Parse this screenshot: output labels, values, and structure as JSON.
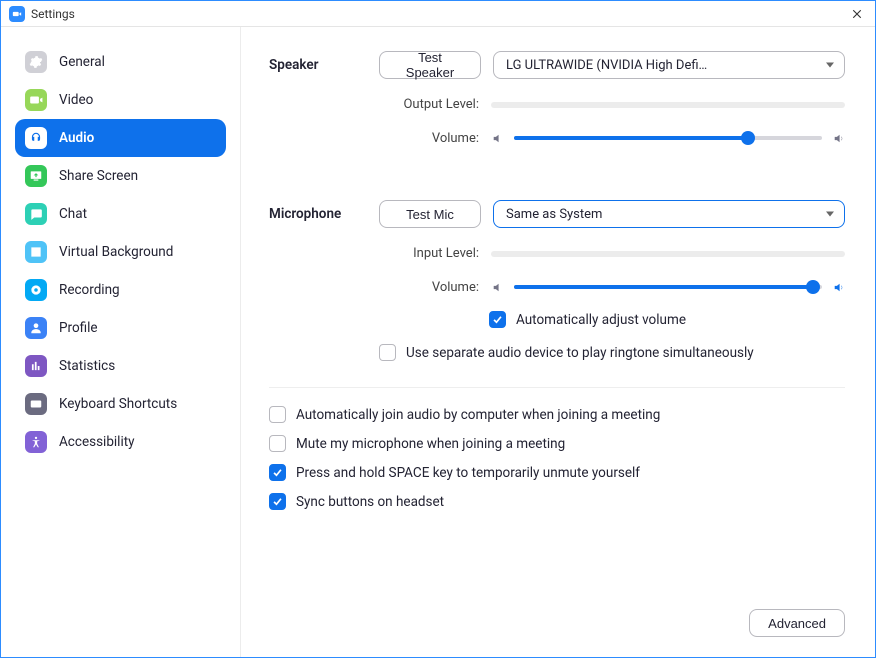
{
  "window": {
    "title": "Settings"
  },
  "sidebar": {
    "items": [
      {
        "label": "General",
        "active": false,
        "icon_bg": "#d0d0d6"
      },
      {
        "label": "Video",
        "active": false,
        "icon_bg": "#97d759"
      },
      {
        "label": "Audio",
        "active": true,
        "icon_bg": "#ffffff"
      },
      {
        "label": "Share Screen",
        "active": false,
        "icon_bg": "#34c759"
      },
      {
        "label": "Chat",
        "active": false,
        "icon_bg": "#2dd0b5"
      },
      {
        "label": "Virtual Background",
        "active": false,
        "icon_bg": "#4fc3f7"
      },
      {
        "label": "Recording",
        "active": false,
        "icon_bg": "#03a9f4"
      },
      {
        "label": "Profile",
        "active": false,
        "icon_bg": "#3b82f6"
      },
      {
        "label": "Statistics",
        "active": false,
        "icon_bg": "#7e57c2"
      },
      {
        "label": "Keyboard Shortcuts",
        "active": false,
        "icon_bg": "#6b6b80"
      },
      {
        "label": "Accessibility",
        "active": false,
        "icon_bg": "#8262d6"
      }
    ]
  },
  "content": {
    "speaker": {
      "label": "Speaker",
      "test_button": "Test Speaker",
      "device": "LG ULTRAWIDE (NVIDIA High Defi…",
      "output_label": "Output Level:",
      "volume_label": "Volume:",
      "volume_percent": 76
    },
    "microphone": {
      "label": "Microphone",
      "test_button": "Test Mic",
      "device": "Same as System",
      "input_label": "Input Level:",
      "volume_label": "Volume:",
      "volume_percent": 97,
      "auto_adjust": {
        "label": "Automatically adjust volume",
        "checked": true
      },
      "separate_ringtone": {
        "label": "Use separate audio device to play ringtone simultaneously",
        "checked": false
      }
    },
    "options": [
      {
        "label": "Automatically join audio by computer when joining a meeting",
        "checked": false
      },
      {
        "label": "Mute my microphone when joining a meeting",
        "checked": false
      },
      {
        "label": "Press and hold SPACE key to temporarily unmute yourself",
        "checked": true
      },
      {
        "label": "Sync buttons on headset",
        "checked": true
      }
    ],
    "advanced_button": "Advanced"
  }
}
